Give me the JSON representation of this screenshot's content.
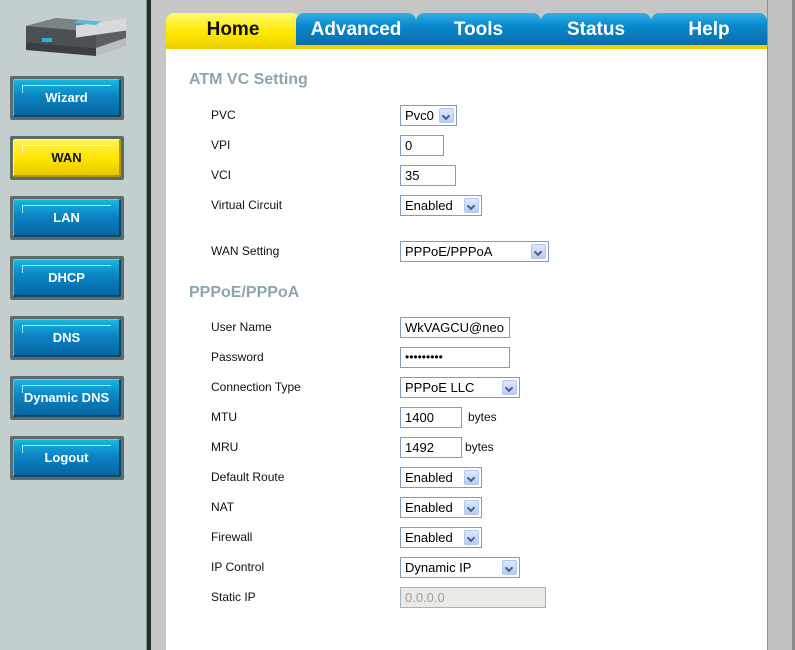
{
  "sidebar": {
    "device_image": "router-device-icon",
    "items": [
      {
        "label": "Wizard",
        "active": false
      },
      {
        "label": "WAN",
        "active": true
      },
      {
        "label": "LAN",
        "active": false
      },
      {
        "label": "DHCP",
        "active": false
      },
      {
        "label": "DNS",
        "active": false
      },
      {
        "label": "Dynamic DNS",
        "active": false
      },
      {
        "label": "Logout",
        "active": false
      }
    ]
  },
  "tabs": [
    {
      "label": "Home",
      "active": true
    },
    {
      "label": "Advanced",
      "active": false
    },
    {
      "label": "Tools",
      "active": false
    },
    {
      "label": "Status",
      "active": false
    },
    {
      "label": "Help",
      "active": false
    }
  ],
  "atm": {
    "title": "ATM VC Setting",
    "pvc_label": "PVC",
    "pvc_value": "Pvc0",
    "vpi_label": "VPI",
    "vpi_value": "0",
    "vci_label": "VCI",
    "vci_value": "35",
    "vc_label": "Virtual Circuit",
    "vc_value": "Enabled",
    "wan_label": "WAN Setting",
    "wan_value": "PPPoE/PPPoA"
  },
  "pppoe": {
    "title": "PPPoE/PPPoA",
    "username_label": "User Name",
    "username_value": "WkVAGCU@neo",
    "password_label": "Password",
    "password_value": "•••••••••",
    "conn_type_label": "Connection Type",
    "conn_type_value": "PPPoE LLC",
    "mtu_label": "MTU",
    "mtu_value": "1400",
    "mtu_unit": "bytes",
    "mru_label": "MRU",
    "mru_value": "1492",
    "mru_unit": "bytes",
    "default_route_label": "Default Route",
    "default_route_value": "Enabled",
    "nat_label": "NAT",
    "nat_value": "Enabled",
    "firewall_label": "Firewall",
    "firewall_value": "Enabled",
    "ip_control_label": "IP Control",
    "ip_control_value": "Dynamic IP",
    "static_ip_label": "Static IP",
    "static_ip_value": "0.0.0.0"
  }
}
